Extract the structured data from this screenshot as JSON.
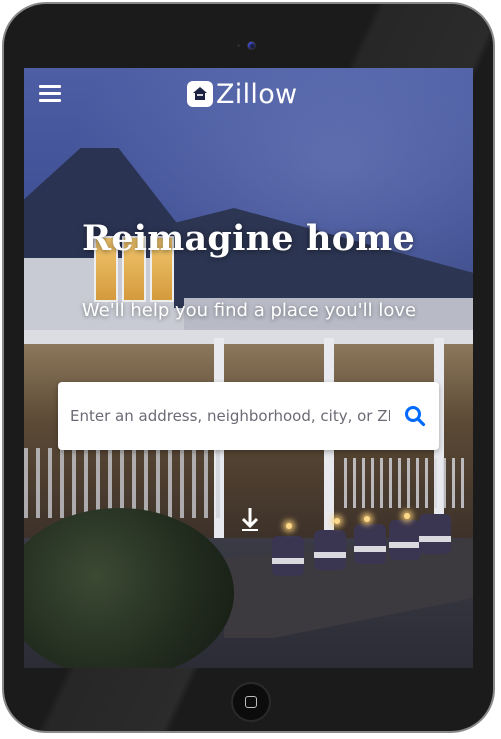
{
  "header": {
    "logo_text": "Zillow"
  },
  "hero": {
    "headline": "Reimagine home",
    "subheadline": "We'll help you find a place you'll love"
  },
  "search": {
    "placeholder": "Enter an address, neighborhood, city, or ZIP code"
  },
  "icons": {
    "menu": "hamburger-menu-icon",
    "search": "magnifier-icon",
    "scroll": "down-arrow-icon",
    "logo": "house-logo-icon"
  },
  "colors": {
    "accent": "#006aff",
    "text_on_hero": "#ffffff"
  }
}
